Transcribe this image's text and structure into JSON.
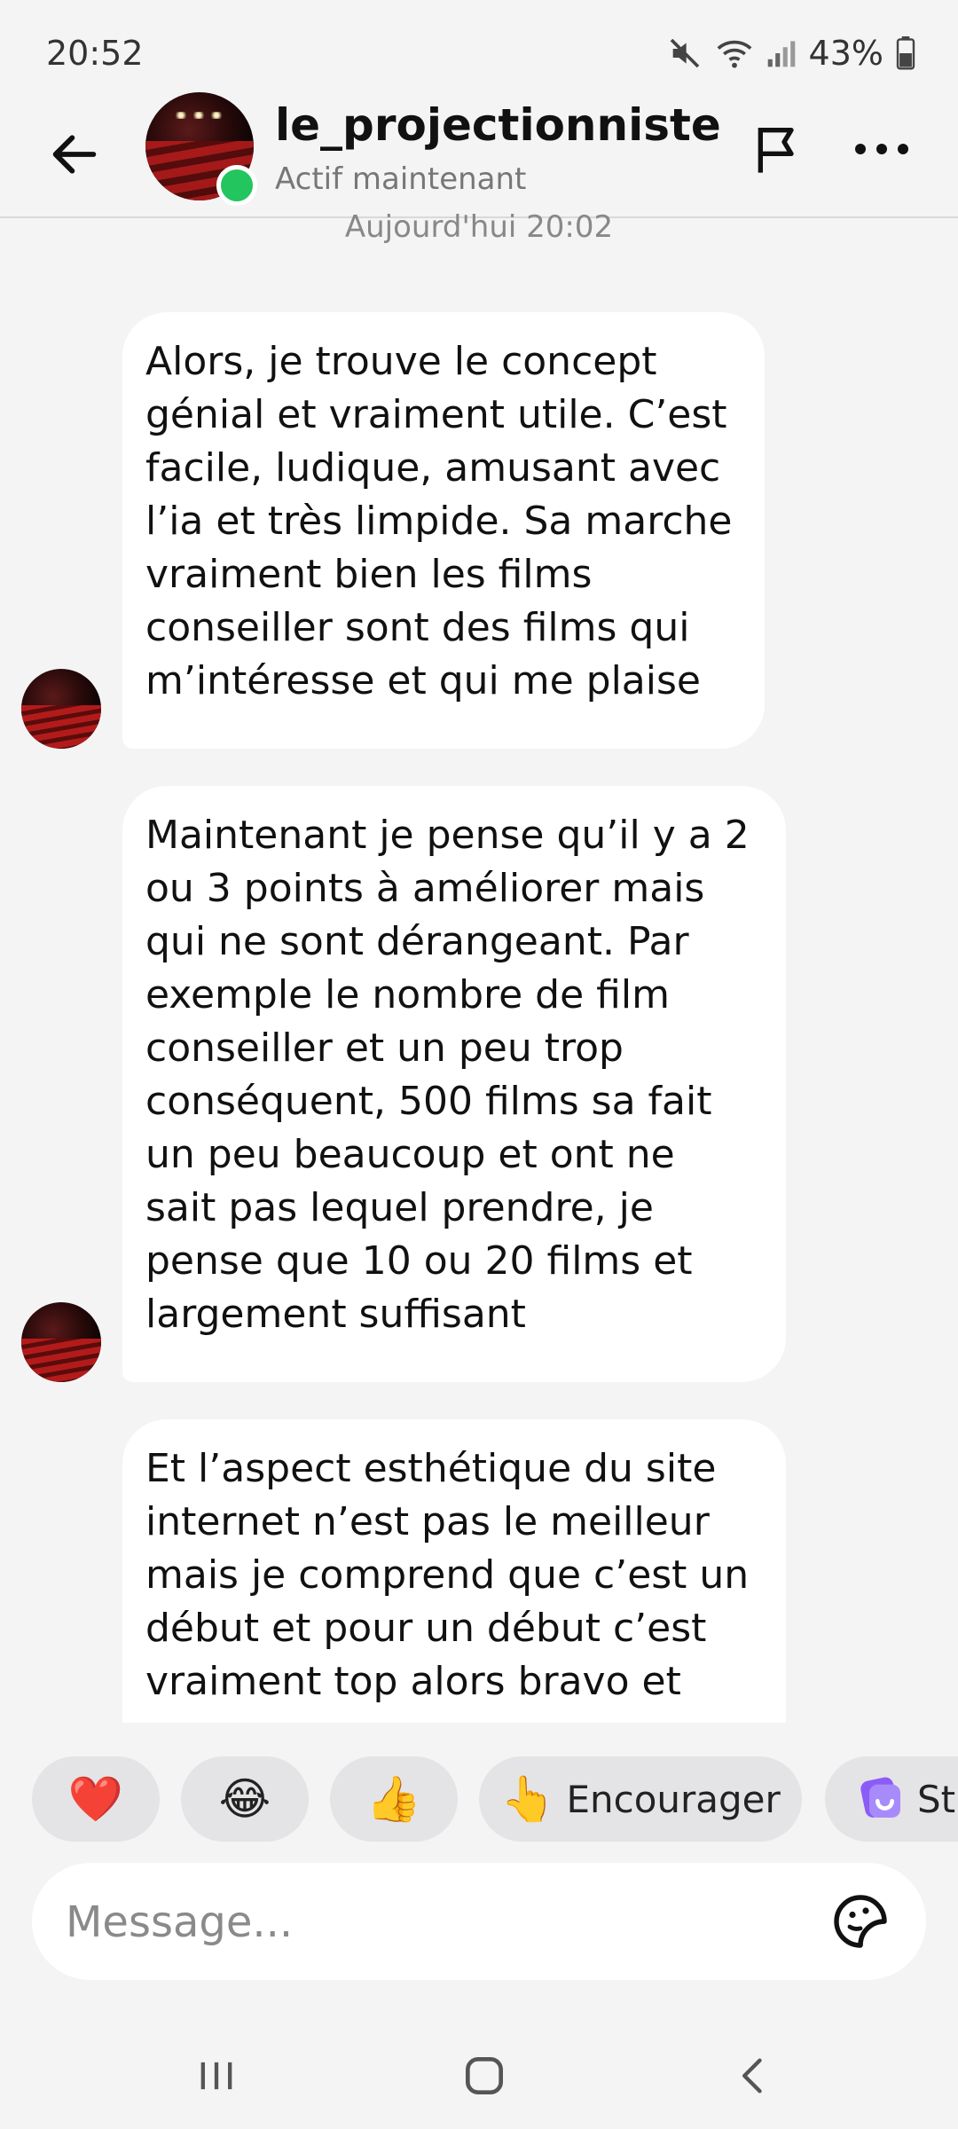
{
  "status_bar": {
    "time": "20:52",
    "battery": "43%",
    "icons": [
      "mute-icon",
      "wifi-icon",
      "signal-icon",
      "battery-icon"
    ]
  },
  "header": {
    "contact_name": "le_projectionniste",
    "contact_status": "Actif maintenant",
    "icons": [
      "back-arrow-icon",
      "flag-icon",
      "more-icon"
    ]
  },
  "conversation": {
    "timestamp": "Aujourd'hui 20:02",
    "messages": [
      {
        "text": "Alors, je trouve le concept\ngénial et vraiment utile. C’est\nfacile, ludique, amusant avec\nl’ia et très limpide. Sa marche\nvraiment bien les films\nconseiller sont des films qui\nm’intéresse et qui me plaise"
      },
      {
        "text": "Maintenant je pense qu’il y a 2\nou 3 points à améliorer mais\nqui ne sont dérangeant. Par\nexemple le nombre de film\nconseiller et un peu trop\nconséquent, 500 films sa fait\nun peu beaucoup et ont ne\nsait pas lequel prendre, je\npense que 10 ou 20 films et\nlargement suffisant"
      },
      {
        "text": "Et l’aspect esthétique du site\ninternet n’est pas le meilleur\nmais je comprend que c’est un\ndébut et pour un début c’est\nvraiment top alors bravo et"
      }
    ]
  },
  "quick_replies": [
    {
      "emoji": "❤️",
      "label": ""
    },
    {
      "emoji": "😂",
      "label": ""
    },
    {
      "emoji": "👍",
      "label": ""
    },
    {
      "emoji": "👆",
      "label": "Encourager"
    },
    {
      "emoji": "",
      "label": "St"
    }
  ],
  "composer": {
    "placeholder": "Message..."
  },
  "colors": {
    "background": "#f4f4f5",
    "bubble": "#ffffff",
    "online": "#22c55e",
    "chip": "#e4e4e6"
  }
}
